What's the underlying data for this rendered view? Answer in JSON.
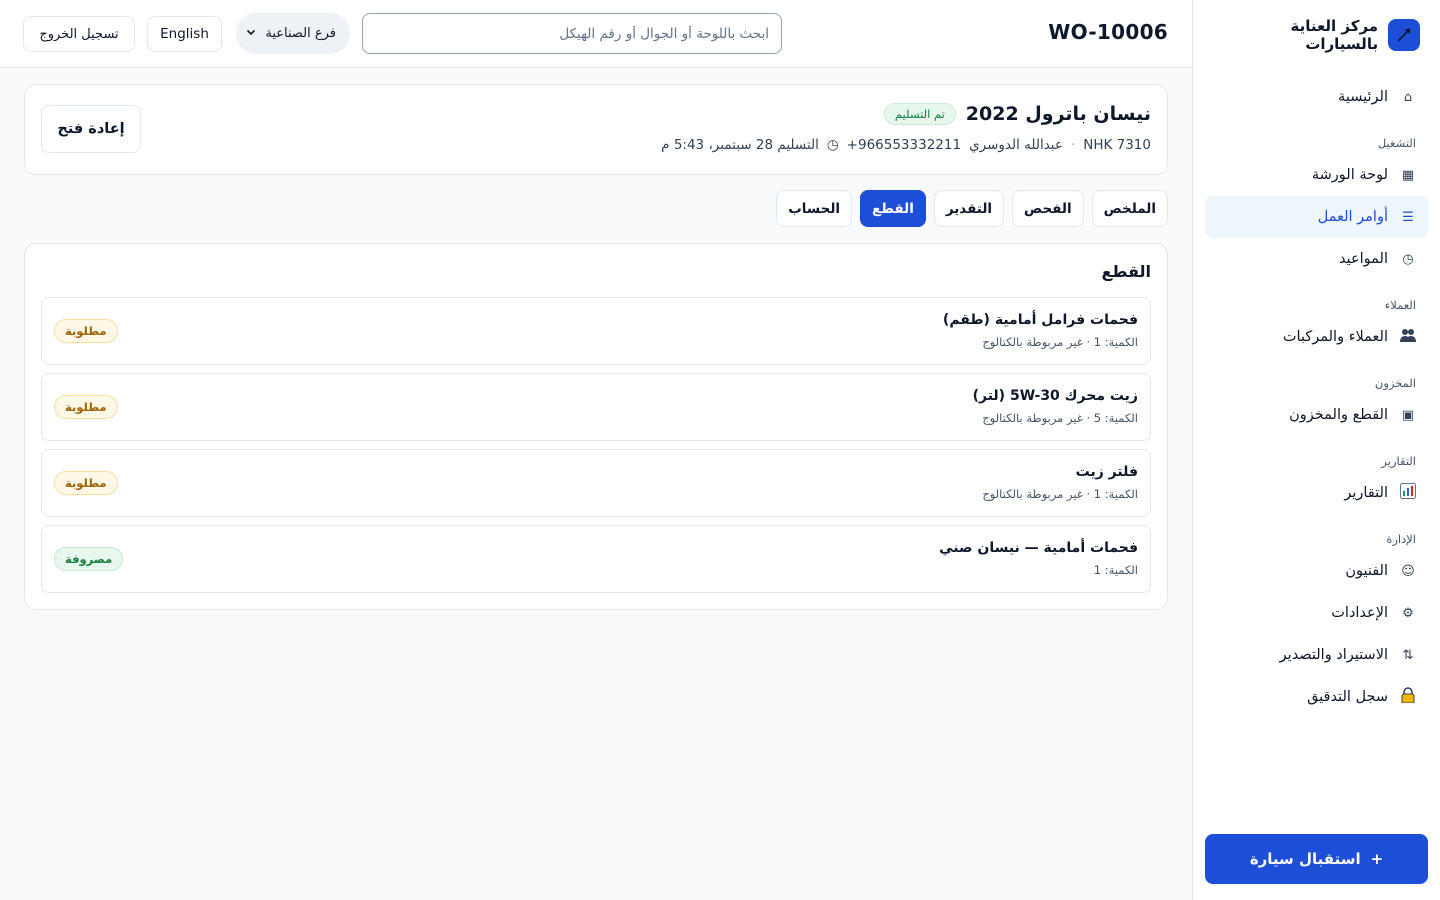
{
  "app": {
    "brand_name": "مركز العناية بالسيارات"
  },
  "sidebar": {
    "home": "الرئيسية",
    "sections": {
      "operations": "التشغيل",
      "customers": "العملاء",
      "inventory": "المخزون",
      "reports": "التقارير",
      "admin": "الإدارة"
    },
    "items": {
      "workshop_board": "لوحة الورشة",
      "work_orders": "أوامر العمل",
      "appointments": "المواعيد",
      "customers_vehicles": "العملاء والمركبات",
      "parts_inventory": "القطع والمخزون",
      "reports": "التقارير",
      "technicians": "الفنيون",
      "settings": "الإعدادات",
      "import_export": "الاستيراد والتصدير",
      "audit_log": "سجل التدقيق"
    },
    "cta_label": "استقبال سيارة",
    "active_item": "work_orders"
  },
  "topbar": {
    "work_order_id": "WO-10006",
    "search_placeholder": "ابحث باللوحة أو الجوال أو رقم الهيكل",
    "branch_label": "فرع الصناعية",
    "language_label": "English",
    "logout_label": "تسجيل الخروج"
  },
  "vehicle": {
    "title": "نيسان باترول 2022",
    "status_badge": "تم التسليم",
    "plate": "NHK 7310",
    "owner": "عبدالله الدوسري",
    "phone": "+966553332211",
    "delivery": "التسليم 28 سبتمبر، 5:43 م",
    "reopen_label": "إعادة فتح"
  },
  "tabs": [
    {
      "label": "الملخص",
      "active": false
    },
    {
      "label": "الفحص",
      "active": false
    },
    {
      "label": "التقدير",
      "active": false
    },
    {
      "label": "القطع",
      "active": true
    },
    {
      "label": "الحساب",
      "active": false
    }
  ],
  "parts": {
    "title": "القطع",
    "items": [
      {
        "name": "فحمات فرامل أمامية (طقم)",
        "details": "الكمية: 1 · غير مربوطة بالكتالوج",
        "status": "مطلوبة",
        "status_type": "required"
      },
      {
        "name": "زيت محرك 5W-30 (لتر)",
        "details": "الكمية: 5 · غير مربوطة بالكتالوج",
        "status": "مطلوبة",
        "status_type": "required"
      },
      {
        "name": "فلتر زيت",
        "details": "الكمية: 1 · غير مربوطة بالكتالوج",
        "status": "مطلوبة",
        "status_type": "required"
      },
      {
        "name": "فحمات أمامية — نيسان صني",
        "details": "الكمية: 1",
        "status": "مصروفة",
        "status_type": "consumed"
      }
    ]
  },
  "colors": {
    "accent": "#1d4ed8",
    "required_badge": "#a16207",
    "consumed_badge": "#15803d"
  },
  "icons": {
    "brand": "wrench-icon",
    "home": "home-icon",
    "workshop_board": "grid-icon",
    "work_orders": "list-icon",
    "appointments": "clock-icon",
    "customers_vehicles": "users-icon",
    "parts_inventory": "box-icon",
    "reports": "bar-chart-icon",
    "technicians": "smile-icon",
    "settings": "gear-icon",
    "import_export": "swap-icon",
    "audit_log": "lock-icon"
  }
}
